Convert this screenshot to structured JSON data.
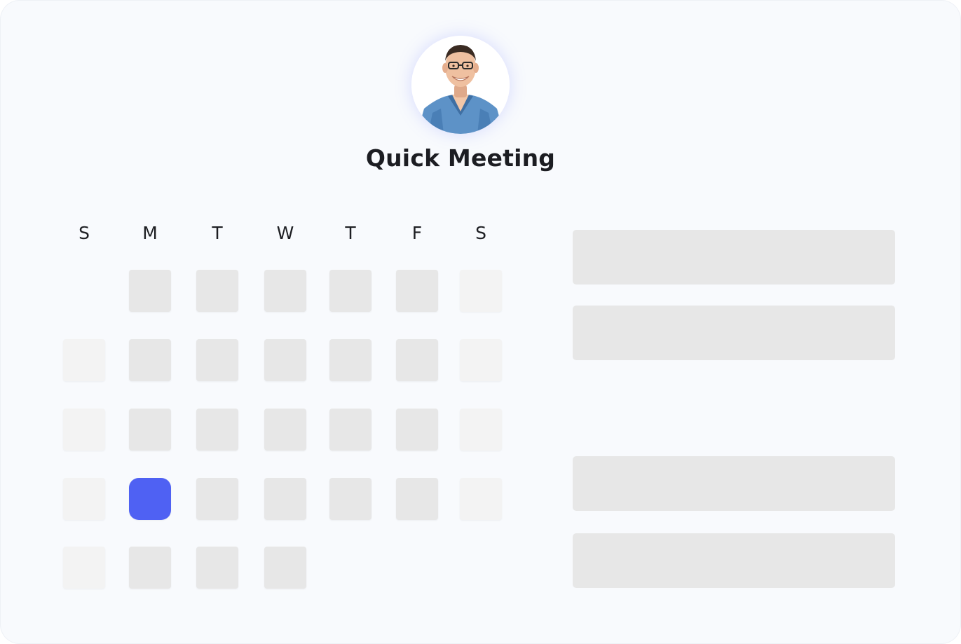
{
  "meeting": {
    "title": "Quick Meeting",
    "avatar_icon": "person-photo-icon"
  },
  "calendar": {
    "weekdays": [
      "S",
      "M",
      "T",
      "W",
      "T",
      "F",
      "S"
    ],
    "selected_color": "#4f61f3",
    "rows": [
      [
        null,
        "available",
        "available",
        "available",
        "available",
        "available",
        "unavailable"
      ],
      [
        "unavailable",
        "available",
        "available",
        "available",
        "available",
        "available",
        "unavailable"
      ],
      [
        "unavailable",
        "available",
        "available",
        "available",
        "available",
        "available",
        "unavailable"
      ],
      [
        "unavailable",
        "selected",
        "available",
        "available",
        "available",
        "available",
        "unavailable"
      ],
      [
        "unavailable",
        "available",
        "available",
        "available",
        null,
        null,
        null
      ]
    ]
  },
  "time_slots": {
    "count": 4
  }
}
